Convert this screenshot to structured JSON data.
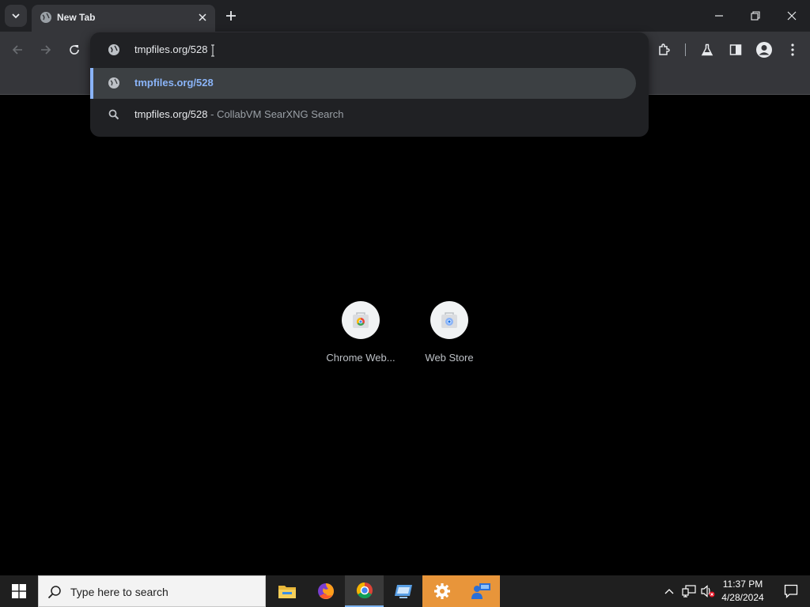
{
  "browser": {
    "tab": {
      "title": "New Tab",
      "favicon": "globe-icon"
    },
    "window_controls": [
      "minimize-icon",
      "restore-icon",
      "close-icon"
    ],
    "toolbar_icons": [
      "back-arrow-icon",
      "forward-arrow-icon",
      "reload-icon",
      "extensions-puzzle-icon",
      "labs-flask-icon",
      "side-panel-icon",
      "profile-avatar-icon",
      "kebab-menu-icon"
    ]
  },
  "omnibox": {
    "input_value": "tmpfiles.org/528",
    "suggestions": [
      {
        "icon": "globe-icon",
        "text": "tmpfiles.org/528",
        "selected": true
      },
      {
        "icon": "search-icon",
        "text": "tmpfiles.org/528",
        "description": "- CollabVM SearXNG Search",
        "selected": false
      }
    ]
  },
  "ntp": {
    "shortcuts": [
      {
        "label": "Chrome Web...",
        "icon": "chrome-web-store-icon"
      },
      {
        "label": "Web Store",
        "icon": "web-store-icon"
      }
    ]
  },
  "taskbar": {
    "search_placeholder": "Type here to search",
    "apps": [
      "file-explorer-icon",
      "firefox-icon",
      "chrome-icon",
      "remote-desktop-icon",
      "settings-gear-icon",
      "users-icon"
    ],
    "clock": {
      "time": "11:37 PM",
      "date": "4/28/2024"
    }
  },
  "colors": {
    "accent": "#8ab4f8",
    "toolbar": "#35363a",
    "frame": "#202124",
    "taskbar_highlight": "#e8953a"
  }
}
